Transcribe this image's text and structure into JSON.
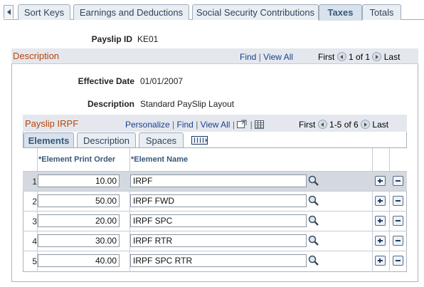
{
  "tabs": [
    {
      "label": "Sort Keys",
      "active": false
    },
    {
      "label": "Earnings and Deductions",
      "active": false
    },
    {
      "label": "Social Security Contributions",
      "active": false
    },
    {
      "label": "Taxes",
      "active": true
    },
    {
      "label": "Totals",
      "active": false
    }
  ],
  "payslip": {
    "label": "Payslip ID",
    "value": "KE01"
  },
  "description_group": {
    "title": "Description",
    "find": "Find",
    "separator": "|",
    "view_all": "View All",
    "first": "First",
    "range": "1 of 1",
    "last": "Last"
  },
  "effective_date": {
    "label": "Effective Date",
    "value": "01/01/2007"
  },
  "description": {
    "label": "Description",
    "value": "Standard PaySlip Layout"
  },
  "grid": {
    "title": "Payslip IRPF",
    "personalize": "Personalize",
    "find": "Find",
    "view_all": "View All",
    "first": "First",
    "range": "1-5 of 6",
    "last": "Last",
    "tabs": [
      {
        "label": "Elements",
        "active": true
      },
      {
        "label": "Description",
        "active": false
      },
      {
        "label": "Spaces",
        "active": false
      }
    ],
    "columns": [
      "*Element Print Order",
      "*Element Name"
    ],
    "rows": [
      {
        "num": "1",
        "order": "10.00",
        "name": "IRPF"
      },
      {
        "num": "2",
        "order": "50.00",
        "name": "IRPF FWD"
      },
      {
        "num": "3",
        "order": "20.00",
        "name": "IRPF SPC"
      },
      {
        "num": "4",
        "order": "30.00",
        "name": "IRPF RTR"
      },
      {
        "num": "5",
        "order": "40.00",
        "name": "IRPF SPC RTR"
      }
    ]
  },
  "icons": {
    "lookup": "magnifier-icon",
    "add": "plus-icon",
    "delete": "minus-icon",
    "zoom": "zoom-icon",
    "download": "spreadsheet-icon",
    "show_all_columns": "show-all-columns-icon"
  },
  "colors": {
    "group_title": "#b4460a",
    "link": "#1a3f8c",
    "header_bg": "#e4e8ee",
    "tab_active_bg": "#d9e2ec"
  }
}
